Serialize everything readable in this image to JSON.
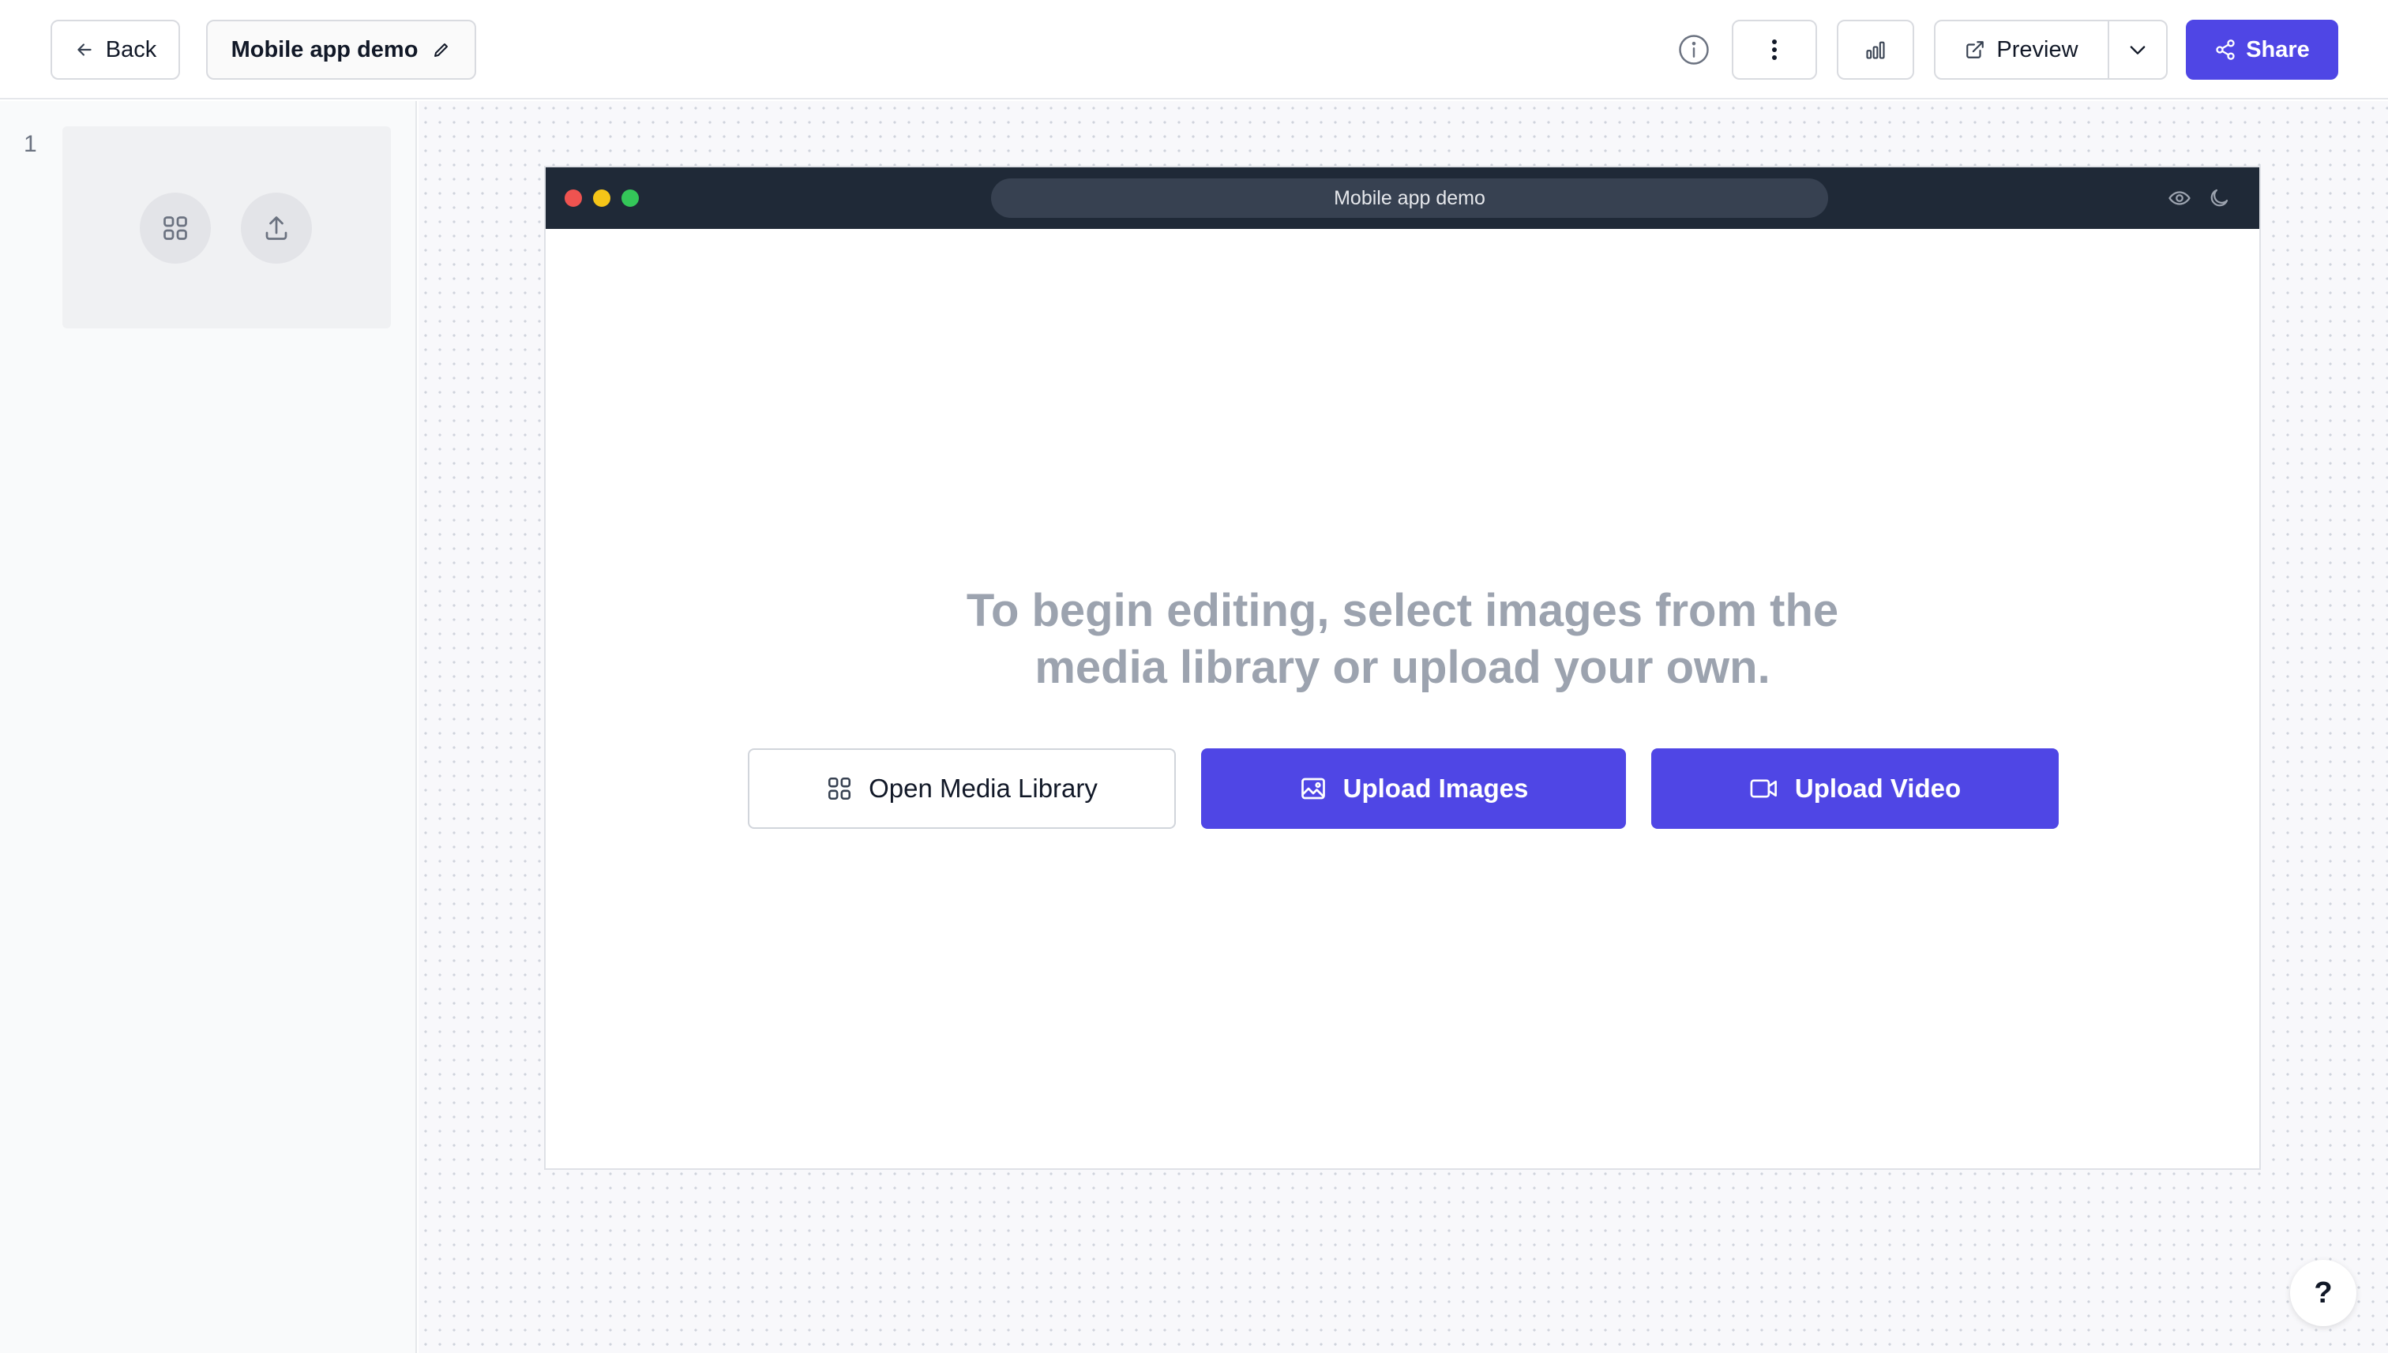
{
  "header": {
    "back_label": "Back",
    "document_title": "Mobile app demo",
    "preview_label": "Preview",
    "share_label": "Share"
  },
  "sidebar": {
    "slides": [
      {
        "number": "1"
      }
    ]
  },
  "browser_frame": {
    "url_title": "Mobile app demo"
  },
  "empty_state": {
    "headline_line1": "To begin editing, select images from the",
    "headline_line2": "media library or upload your own.",
    "open_library_label": "Open Media Library",
    "upload_images_label": "Upload Images",
    "upload_video_label": "Upload Video"
  },
  "help": {
    "label": "?"
  },
  "colors": {
    "accent": "#4f46e5",
    "browser_bar": "#1f2937",
    "headline_text": "#9ca3af"
  }
}
